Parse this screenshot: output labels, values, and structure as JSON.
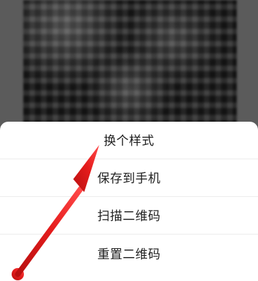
{
  "sheet": {
    "items": [
      {
        "label": "换个样式"
      },
      {
        "label": "保存到手机"
      },
      {
        "label": "扫描二维码"
      },
      {
        "label": "重置二维码"
      }
    ]
  },
  "annotation": {
    "icon": "red-arrow-icon",
    "color": "#e31818"
  }
}
